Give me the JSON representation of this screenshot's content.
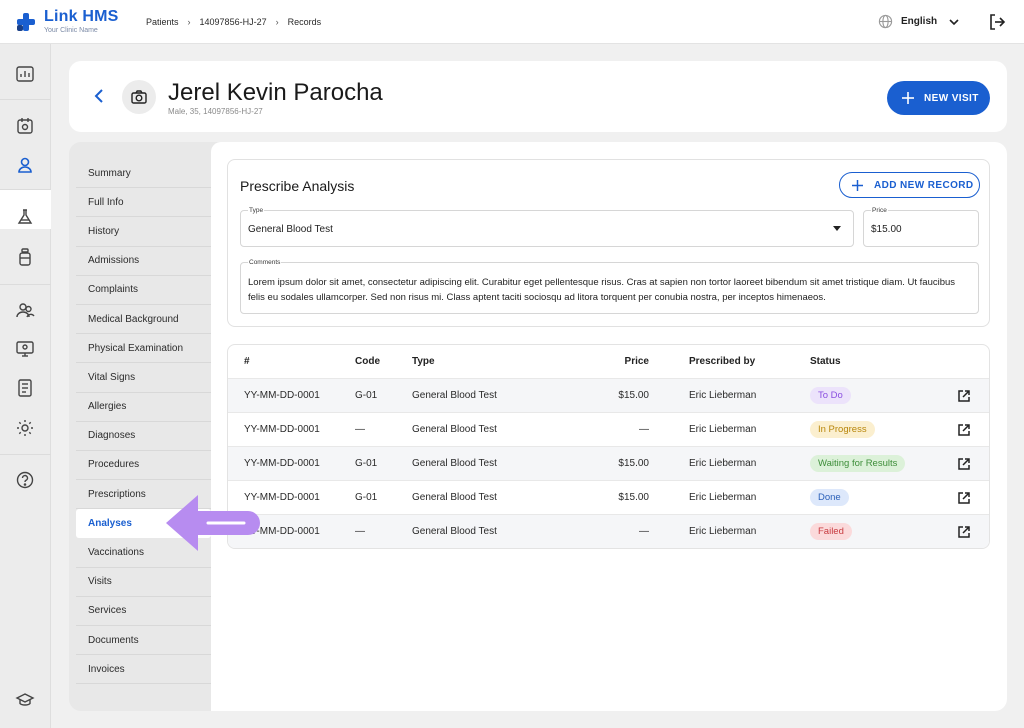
{
  "app": {
    "name": "Link HMS",
    "tagline": "Your Clinic Name"
  },
  "colors": {
    "brand": "#1a5fd0",
    "arrow": "#b78cf0",
    "todo": "#ece3fb",
    "in_progress": "#fbefcf",
    "waiting": "#dcf1d9",
    "done": "#dde8fb",
    "failed": "#fbdadb"
  },
  "breadcrumb": [
    "Patients",
    "14097856-HJ-27",
    "Records"
  ],
  "language": "English",
  "rail_icons": [
    "dashboard-icon",
    "calendar-icon",
    "user-icon",
    "flask-icon",
    "bottle-icon",
    "group-icon",
    "monitor-icon",
    "document-icon",
    "settings-icon",
    "help-icon",
    "graduation-cap-icon"
  ],
  "patient": {
    "name": "Jerel Kevin Parocha",
    "meta": "Male, 35, 14097856-HJ-27"
  },
  "actions": {
    "new_visit": "NEW VISIT",
    "add_record": "ADD NEW RECORD"
  },
  "nav": {
    "items": [
      "Summary",
      "Full Info",
      "History",
      "Admissions",
      "Complaints",
      "Medical Background",
      "Physical Examination",
      "Vital Signs",
      "Allergies",
      "Diagnoses",
      "Procedures",
      "Prescriptions",
      "Analyses",
      "Vaccinations",
      "Visits",
      "Services",
      "Documents",
      "Invoices"
    ],
    "active": "Analyses"
  },
  "form": {
    "title": "Prescribe Analysis",
    "type_label": "Type",
    "type_value": "General Blood Test",
    "price_label": "Price",
    "price_value": "$15.00",
    "comments_label": "Comments",
    "comments_value": "Lorem ipsum dolor sit amet, consectetur adipiscing elit. Curabitur eget pellentesque risus. Cras at sapien non tortor laoreet bibendum sit amet tristique diam. Ut faucibus felis eu sodales ullamcorper. Sed non risus mi. Class aptent taciti sociosqu ad litora torquent per conubia nostra, per inceptos himenaeos."
  },
  "table": {
    "headers": {
      "id": "#",
      "code": "Code",
      "type": "Type",
      "price": "Price",
      "prescribed_by": "Prescribed by",
      "status": "Status"
    },
    "rows": [
      {
        "id": "YY-MM-DD-0001",
        "code": "G-01",
        "type": "General Blood Test",
        "price": "$15.00",
        "prescribed_by": "Eric Lieberman",
        "status": "To Do",
        "status_key": "todo"
      },
      {
        "id": "YY-MM-DD-0001",
        "code": "—",
        "type": "General Blood Test",
        "price": "—",
        "prescribed_by": "Eric Lieberman",
        "status": "In Progress",
        "status_key": "in_progress"
      },
      {
        "id": "YY-MM-DD-0001",
        "code": "G-01",
        "type": "General Blood Test",
        "price": "$15.00",
        "prescribed_by": "Eric Lieberman",
        "status": "Waiting for Results",
        "status_key": "waiting"
      },
      {
        "id": "YY-MM-DD-0001",
        "code": "G-01",
        "type": "General Blood Test",
        "price": "$15.00",
        "prescribed_by": "Eric Lieberman",
        "status": "Done",
        "status_key": "done"
      },
      {
        "id": "YY-MM-DD-0001",
        "code": "—",
        "type": "General Blood Test",
        "price": "—",
        "prescribed_by": "Eric Lieberman",
        "status": "Failed",
        "status_key": "failed"
      }
    ]
  }
}
